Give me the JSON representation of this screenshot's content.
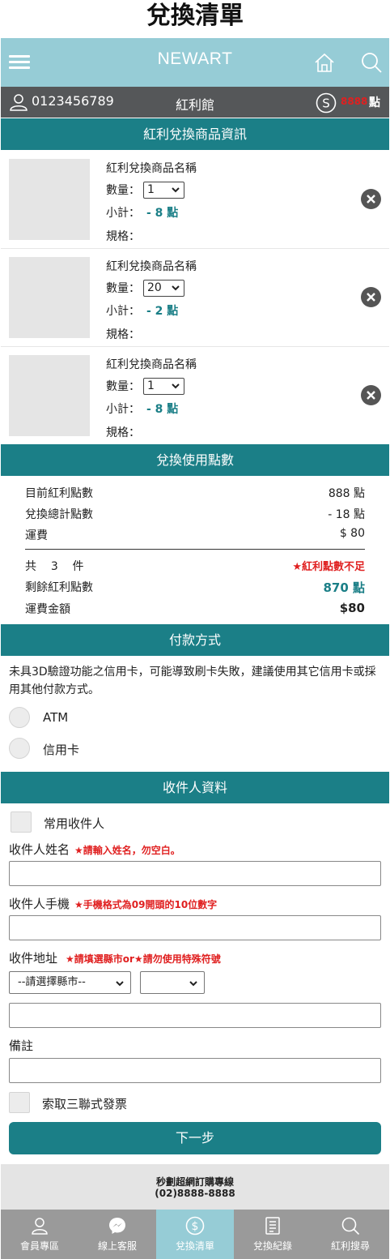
{
  "page_title": "兌換清單",
  "header": {
    "brand": "NEWART"
  },
  "userbar": {
    "phone": "0123456789",
    "title": "紅利館",
    "points_value": "8888",
    "points_unit": "點"
  },
  "sections": {
    "products": "紅利兌換商品資訊",
    "points": "兌換使用點數",
    "payment": "付款方式",
    "recipient": "收件人資料"
  },
  "item_labels": {
    "qty": "數量：",
    "subtotal": "小計：",
    "spec": "規格："
  },
  "items": [
    {
      "name": "紅利兌換商品名稱",
      "qty": "1",
      "subtotal": "- 8 點"
    },
    {
      "name": "紅利兌換商品名稱",
      "qty": "20",
      "subtotal": "- 2 點"
    },
    {
      "name": "紅利兌換商品名稱",
      "qty": "1",
      "subtotal": "- 8 點"
    }
  ],
  "summary": {
    "current_label": "目前紅利點數",
    "current_value": "888 點",
    "total_label": "兌換總計點數",
    "total_value": "- 18 點",
    "shipping_label": "運費",
    "shipping_value": "$ 80",
    "count_prefix": "共",
    "count_value": "3",
    "count_suffix": "件",
    "warning": "★紅利點數不足",
    "remaining_label": "剩餘紅利點數",
    "remaining_value": "870 點",
    "shipping_amount_label": "運費金額",
    "shipping_amount_value": "$80"
  },
  "payment": {
    "note": "未具3D驗證功能之信用卡，可能導致刷卡失敗，建議使用其它信用卡或採用其他付款方式。",
    "options": [
      "ATM",
      "信用卡"
    ]
  },
  "recipient": {
    "common_label": "常用收件人",
    "name_label": "收件人姓名",
    "name_hint": "★請輸入姓名，勿空白。",
    "phone_label": "收件人手機",
    "phone_hint": "★手機格式為09開頭的10位數字",
    "address_label": "收件地址",
    "address_hint": "★請填選縣市or★請勿使用特殊符號",
    "city_placeholder": "--請選擇縣市--",
    "district_placeholder": "",
    "note_label": "備註",
    "invoice_label": "索取三聯式發票"
  },
  "next_button": "下一步",
  "footer": {
    "hotline_label": "秒劃超網訂購專線",
    "hotline_number": "(02)8888-8888"
  },
  "tabs": [
    {
      "label": "會員專區",
      "icon": "member-icon"
    },
    {
      "label": "線上客服",
      "icon": "messenger-icon"
    },
    {
      "label": "兌換清單",
      "icon": "dollar-icon",
      "active": true
    },
    {
      "label": "兌換紀錄",
      "icon": "record-icon"
    },
    {
      "label": "紅利搜尋",
      "icon": "search-icon"
    }
  ],
  "colors": {
    "teal": "#1b7f87",
    "light_teal": "#96ccd6",
    "dark_bar": "#555759",
    "alert_red": "#e02020"
  }
}
